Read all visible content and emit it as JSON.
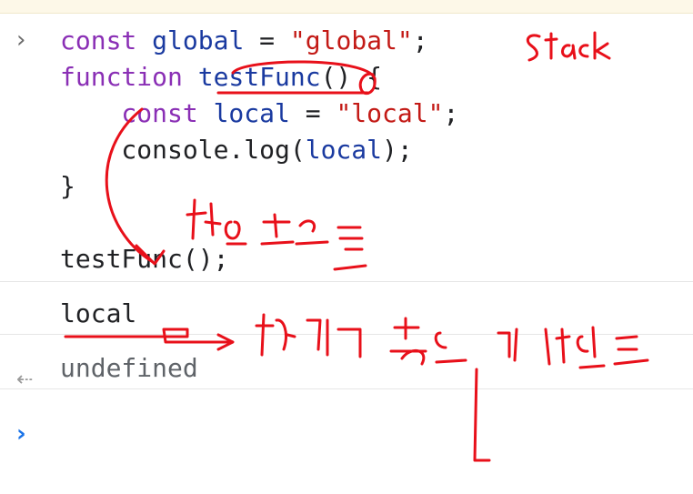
{
  "console": {
    "code_lines": [
      [
        {
          "t": "const ",
          "c": "kw"
        },
        {
          "t": "global",
          "c": "var"
        },
        {
          "t": " = ",
          "c": "plain"
        },
        {
          "t": "\"global\"",
          "c": "str"
        },
        {
          "t": ";",
          "c": "plain"
        }
      ],
      [
        {
          "t": "function ",
          "c": "kw"
        },
        {
          "t": "testFunc",
          "c": "var"
        },
        {
          "t": "() {",
          "c": "plain"
        }
      ],
      [
        {
          "t": "    const ",
          "c": "kw"
        },
        {
          "t": "local",
          "c": "var"
        },
        {
          "t": " = ",
          "c": "plain"
        },
        {
          "t": "\"local\"",
          "c": "str"
        },
        {
          "t": ";",
          "c": "plain"
        }
      ],
      [
        {
          "t": "    console.log(",
          "c": "plain"
        },
        {
          "t": "local",
          "c": "var"
        },
        {
          "t": ");",
          "c": "plain"
        }
      ],
      [
        {
          "t": "}",
          "c": "plain"
        }
      ],
      [
        {
          "t": "",
          "c": "plain"
        }
      ],
      [
        {
          "t": "testFunc();",
          "c": "plain"
        }
      ]
    ],
    "log_output": "local",
    "result_output": "undefined",
    "input_prompt_icon": "chevron-right-icon",
    "result_prompt_icon": "return-arrow-icon",
    "active_prompt_icon": "chevron-right-icon"
  },
  "annotations": {
    "stack_label": "Stack",
    "handwritten_notes": [
      "함수호출",
      "함수가 호출된 때 반환됨"
    ]
  },
  "colors": {
    "keyword": "#8a2fb5",
    "variable": "#1a3aa0",
    "string": "#c31a16",
    "ink": "#e8101a",
    "prompt_active": "#1a73e8"
  }
}
